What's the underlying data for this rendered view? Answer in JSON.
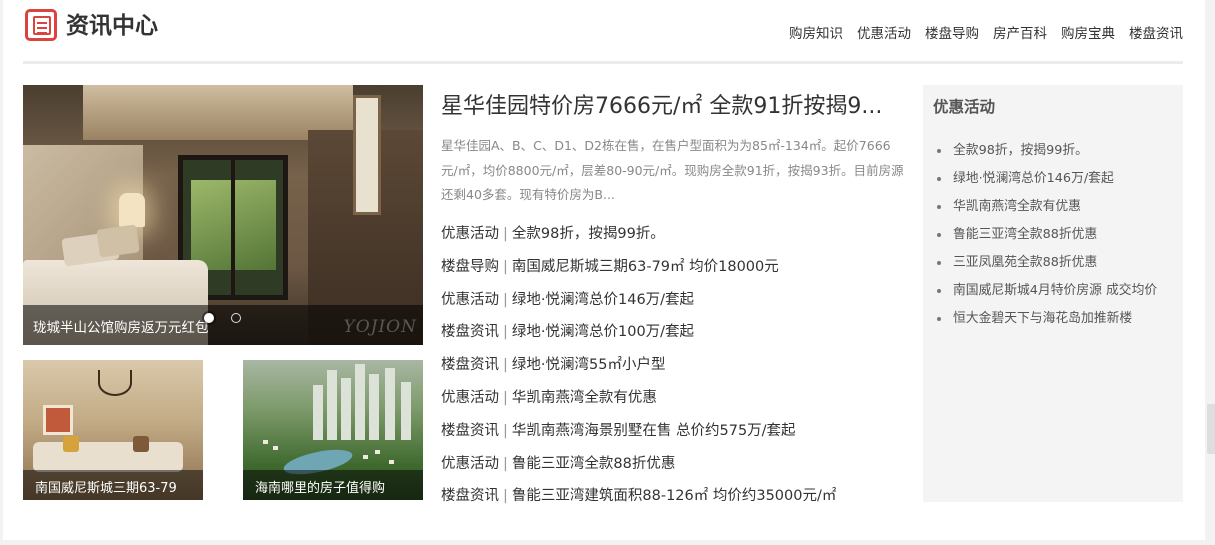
{
  "header": {
    "title": "资讯中心",
    "icon": "newspaper-icon",
    "accent": "#d9443f",
    "nav": [
      "购房知识",
      "优惠活动",
      "楼盘导购",
      "房产百科",
      "购房宝典",
      "楼盘资讯"
    ]
  },
  "slideshow": {
    "caption": "珑城半山公馆购房返万元红包",
    "watermark": "YOJION",
    "active_index": 1,
    "count": 2
  },
  "thumbnails": [
    {
      "caption": "南国威尼斯城三期63-79"
    },
    {
      "caption": "海南哪里的房子值得购"
    }
  ],
  "headline": {
    "title": "星华佳园特价房7666元/㎡ 全款91折按揭9...",
    "summary": "星华佳园A、B、C、D1、D2栋在售，在售户型面积为为85㎡-134㎡。起价7666元/㎡，均价8800元/㎡，层差80-90元/㎡。现购房全款91折，按揭93折。目前房源还剩40多套。现有特价房为B..."
  },
  "news": [
    {
      "category": "优惠活动",
      "title": "全款98折，按揭99折。"
    },
    {
      "category": "楼盘导购",
      "title": "南国威尼斯城三期63-79㎡ 均价18000元"
    },
    {
      "category": "优惠活动",
      "title": "绿地·悦澜湾总价146万/套起"
    },
    {
      "category": "楼盘资讯",
      "title": "绿地·悦澜湾总价100万/套起"
    },
    {
      "category": "楼盘资讯",
      "title": "绿地·悦澜湾55㎡小户型"
    },
    {
      "category": "优惠活动",
      "title": "华凯南燕湾全款有优惠"
    },
    {
      "category": "楼盘资讯",
      "title": "华凯南燕湾海景别墅在售 总价约575万/套起"
    },
    {
      "category": "优惠活动",
      "title": "鲁能三亚湾全款88折优惠"
    },
    {
      "category": "楼盘资讯",
      "title": "鲁能三亚湾建筑面积88-126㎡ 均价约35000元/㎡"
    }
  ],
  "news_separator": "|",
  "sidebar": {
    "title": "优惠活动",
    "items": [
      "全款98折，按揭99折。",
      "绿地·悦澜湾总价146万/套起",
      "华凯南燕湾全款有优惠",
      "鲁能三亚湾全款88折优惠",
      "三亚凤凰苑全款88折优惠",
      "南国威尼斯城4月特价房源 成交均价",
      "恒大金碧天下与海花岛加推新楼"
    ]
  }
}
